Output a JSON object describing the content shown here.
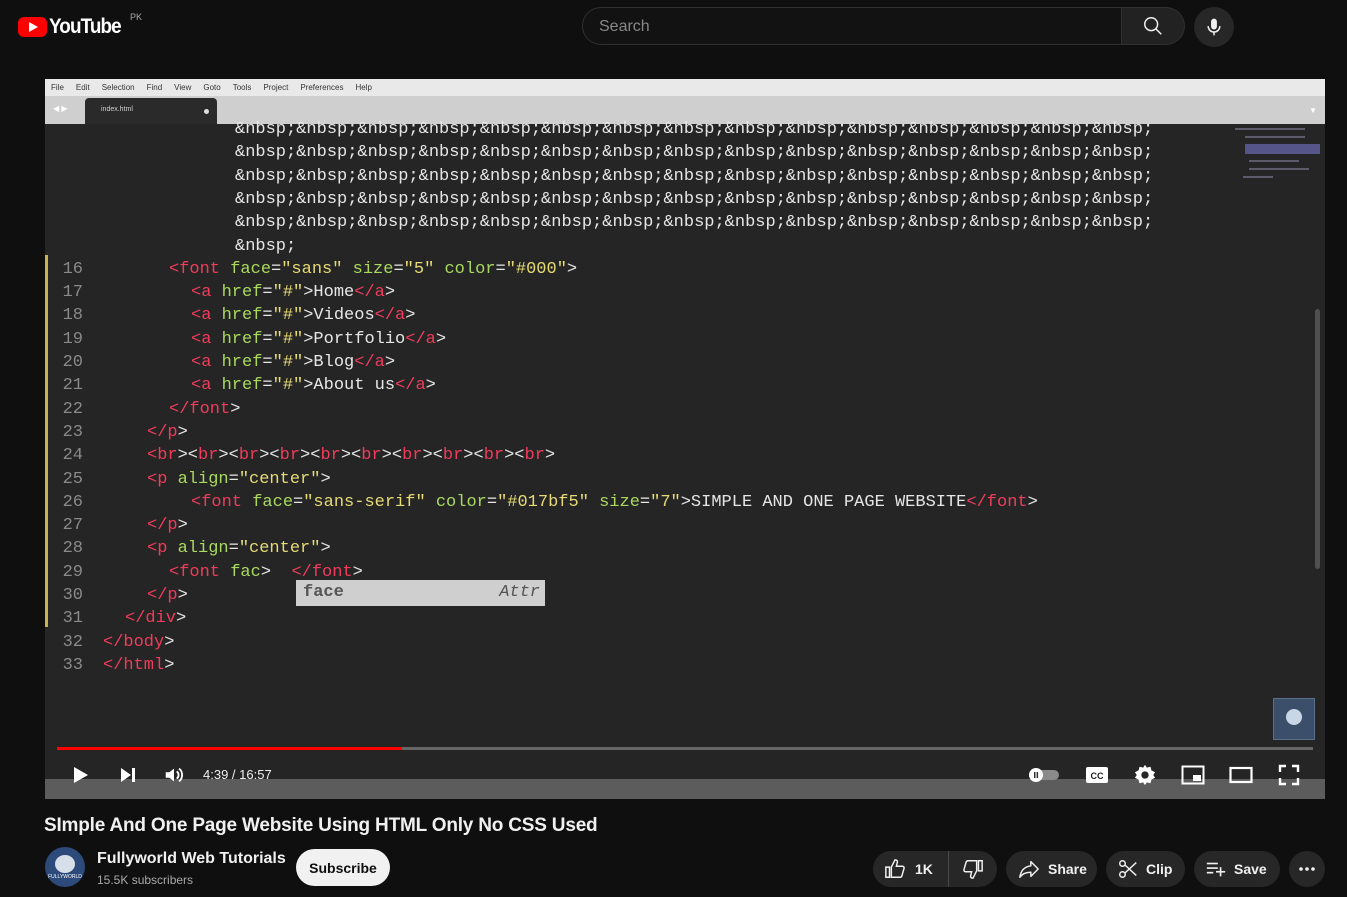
{
  "header": {
    "logo_text": "YouTube",
    "region": "PK",
    "search_placeholder": "Search"
  },
  "editor": {
    "menu": [
      "File",
      "Edit",
      "Selection",
      "Find",
      "View",
      "Goto",
      "Tools",
      "Project",
      "Preferences",
      "Help"
    ],
    "tab_name": "index.html",
    "nbsp_lines": [
      "&nbsp;&nbsp;&nbsp;&nbsp;&nbsp;&nbsp;&nbsp;&nbsp;&nbsp;&nbsp;&nbsp;&nbsp;&nbsp;&nbsp;&nbsp;",
      "&nbsp;&nbsp;&nbsp;&nbsp;&nbsp;&nbsp;&nbsp;&nbsp;&nbsp;&nbsp;&nbsp;&nbsp;&nbsp;&nbsp;&nbsp;",
      "&nbsp;&nbsp;&nbsp;&nbsp;&nbsp;&nbsp;&nbsp;&nbsp;&nbsp;&nbsp;&nbsp;&nbsp;&nbsp;&nbsp;&nbsp;",
      "&nbsp;&nbsp;&nbsp;&nbsp;&nbsp;&nbsp;&nbsp;&nbsp;&nbsp;&nbsp;&nbsp;&nbsp;&nbsp;&nbsp;&nbsp;",
      "&nbsp;&nbsp;&nbsp;&nbsp;&nbsp;&nbsp;&nbsp;&nbsp;&nbsp;&nbsp;&nbsp;&nbsp;&nbsp;&nbsp;&nbsp;",
      "&nbsp;"
    ],
    "lines": [
      {
        "n": "16",
        "indent": 6,
        "tokens": [
          [
            "tag",
            "<font"
          ],
          [
            "punc",
            " "
          ],
          [
            "attr",
            "face"
          ],
          [
            "punc",
            "="
          ],
          [
            "str",
            "\"sans\""
          ],
          [
            "punc",
            " "
          ],
          [
            "attr",
            "size"
          ],
          [
            "punc",
            "="
          ],
          [
            "str",
            "\"5\""
          ],
          [
            "punc",
            " "
          ],
          [
            "attr",
            "color"
          ],
          [
            "punc",
            "="
          ],
          [
            "str",
            "\"#000\""
          ],
          [
            "punc",
            ">"
          ]
        ]
      },
      {
        "n": "17",
        "indent": 8,
        "tokens": [
          [
            "tag",
            "<a"
          ],
          [
            "punc",
            " "
          ],
          [
            "attr",
            "href"
          ],
          [
            "punc",
            "="
          ],
          [
            "str",
            "\"#\""
          ],
          [
            "punc",
            ">Home"
          ],
          [
            "tag",
            "</a"
          ],
          [
            "punc",
            ">"
          ]
        ]
      },
      {
        "n": "18",
        "indent": 8,
        "tokens": [
          [
            "tag",
            "<a"
          ],
          [
            "punc",
            " "
          ],
          [
            "attr",
            "href"
          ],
          [
            "punc",
            "="
          ],
          [
            "str",
            "\"#\""
          ],
          [
            "punc",
            ">Videos"
          ],
          [
            "tag",
            "</a"
          ],
          [
            "punc",
            ">"
          ]
        ]
      },
      {
        "n": "19",
        "indent": 8,
        "tokens": [
          [
            "tag",
            "<a"
          ],
          [
            "punc",
            " "
          ],
          [
            "attr",
            "href"
          ],
          [
            "punc",
            "="
          ],
          [
            "str",
            "\"#\""
          ],
          [
            "punc",
            ">Portfolio"
          ],
          [
            "tag",
            "</a"
          ],
          [
            "punc",
            ">"
          ]
        ]
      },
      {
        "n": "20",
        "indent": 8,
        "tokens": [
          [
            "tag",
            "<a"
          ],
          [
            "punc",
            " "
          ],
          [
            "attr",
            "href"
          ],
          [
            "punc",
            "="
          ],
          [
            "str",
            "\"#\""
          ],
          [
            "punc",
            ">Blog"
          ],
          [
            "tag",
            "</a"
          ],
          [
            "punc",
            ">"
          ]
        ]
      },
      {
        "n": "21",
        "indent": 8,
        "tokens": [
          [
            "tag",
            "<a"
          ],
          [
            "punc",
            " "
          ],
          [
            "attr",
            "href"
          ],
          [
            "punc",
            "="
          ],
          [
            "str",
            "\"#\""
          ],
          [
            "punc",
            ">About us"
          ],
          [
            "tag",
            "</a"
          ],
          [
            "punc",
            ">"
          ]
        ]
      },
      {
        "n": "22",
        "indent": 6,
        "tokens": [
          [
            "tag",
            "</font"
          ],
          [
            "punc",
            ">"
          ]
        ]
      },
      {
        "n": "23",
        "indent": 4,
        "tokens": [
          [
            "tag",
            "</p"
          ],
          [
            "punc",
            ">"
          ]
        ]
      },
      {
        "n": "24",
        "indent": 4,
        "tokens": [
          [
            "tag",
            "<br"
          ],
          [
            "punc",
            "><"
          ],
          [
            "tag",
            "br"
          ],
          [
            "punc",
            "><"
          ],
          [
            "tag",
            "br"
          ],
          [
            "punc",
            "><"
          ],
          [
            "tag",
            "br"
          ],
          [
            "punc",
            "><"
          ],
          [
            "tag",
            "br"
          ],
          [
            "punc",
            "><"
          ],
          [
            "tag",
            "br"
          ],
          [
            "punc",
            "><"
          ],
          [
            "tag",
            "br"
          ],
          [
            "punc",
            "><"
          ],
          [
            "tag",
            "br"
          ],
          [
            "punc",
            "><"
          ],
          [
            "tag",
            "br"
          ],
          [
            "punc",
            "><"
          ],
          [
            "tag",
            "br"
          ],
          [
            "punc",
            ">"
          ]
        ]
      },
      {
        "n": "25",
        "indent": 4,
        "tokens": [
          [
            "tag",
            "<p"
          ],
          [
            "punc",
            " "
          ],
          [
            "attr",
            "align"
          ],
          [
            "punc",
            "="
          ],
          [
            "str",
            "\"center\""
          ],
          [
            "punc",
            ">"
          ]
        ]
      },
      {
        "n": "26",
        "indent": 8,
        "tokens": [
          [
            "tag",
            "<font"
          ],
          [
            "punc",
            " "
          ],
          [
            "attr",
            "face"
          ],
          [
            "punc",
            "="
          ],
          [
            "str",
            "\"sans-serif\""
          ],
          [
            "punc",
            " "
          ],
          [
            "attr",
            "color"
          ],
          [
            "punc",
            "="
          ],
          [
            "str",
            "\"#017bf5\""
          ],
          [
            "punc",
            " "
          ],
          [
            "attr",
            "size"
          ],
          [
            "punc",
            "="
          ],
          [
            "str",
            "\"7\""
          ],
          [
            "punc",
            ">SIMPLE AND ONE PAGE WEBSITE"
          ],
          [
            "tag",
            "</font"
          ],
          [
            "punc",
            ">"
          ]
        ]
      },
      {
        "n": "27",
        "indent": 4,
        "tokens": [
          [
            "tag",
            "</p"
          ],
          [
            "punc",
            ">"
          ]
        ]
      },
      {
        "n": "28",
        "indent": 4,
        "tokens": [
          [
            "tag",
            "<p"
          ],
          [
            "punc",
            " "
          ],
          [
            "attr",
            "align"
          ],
          [
            "punc",
            "="
          ],
          [
            "str",
            "\"center\""
          ],
          [
            "punc",
            ">"
          ]
        ]
      },
      {
        "n": "29",
        "indent": 6,
        "tokens": [
          [
            "tag",
            "<font"
          ],
          [
            "punc",
            " "
          ],
          [
            "attr",
            "fac"
          ],
          [
            "punc",
            ">  "
          ],
          [
            "tag",
            "</font"
          ],
          [
            "punc",
            ">"
          ]
        ]
      },
      {
        "n": "30",
        "indent": 4,
        "tokens": [
          [
            "tag",
            "</p"
          ],
          [
            "punc",
            ">"
          ]
        ]
      },
      {
        "n": "31",
        "indent": 2,
        "tokens": [
          [
            "tag",
            "</div"
          ],
          [
            "punc",
            ">"
          ]
        ]
      },
      {
        "n": "32",
        "indent": 0,
        "tokens": [
          [
            "tag",
            "</body"
          ],
          [
            "punc",
            ">"
          ]
        ]
      },
      {
        "n": "33",
        "indent": 0,
        "tokens": [
          [
            "tag",
            "</html"
          ],
          [
            "punc",
            ">"
          ]
        ]
      }
    ],
    "autocomplete": {
      "word": "face",
      "type": "Attr"
    }
  },
  "player": {
    "current_time": "4:39",
    "duration": "16:57",
    "time_display": "4:39 / 16:57",
    "progress_fraction": 0.275,
    "progress_color": "#ff0000"
  },
  "video": {
    "title": "SImple And One Page Website Using HTML Only No CSS Used",
    "channel_name": "Fullyworld Web Tutorials",
    "subscribers": "15.5K subscribers",
    "subscribe_label": "Subscribe",
    "avatar_caption": "FULLYWORLD",
    "like_count": "1K",
    "share_label": "Share",
    "clip_label": "Clip",
    "save_label": "Save"
  }
}
